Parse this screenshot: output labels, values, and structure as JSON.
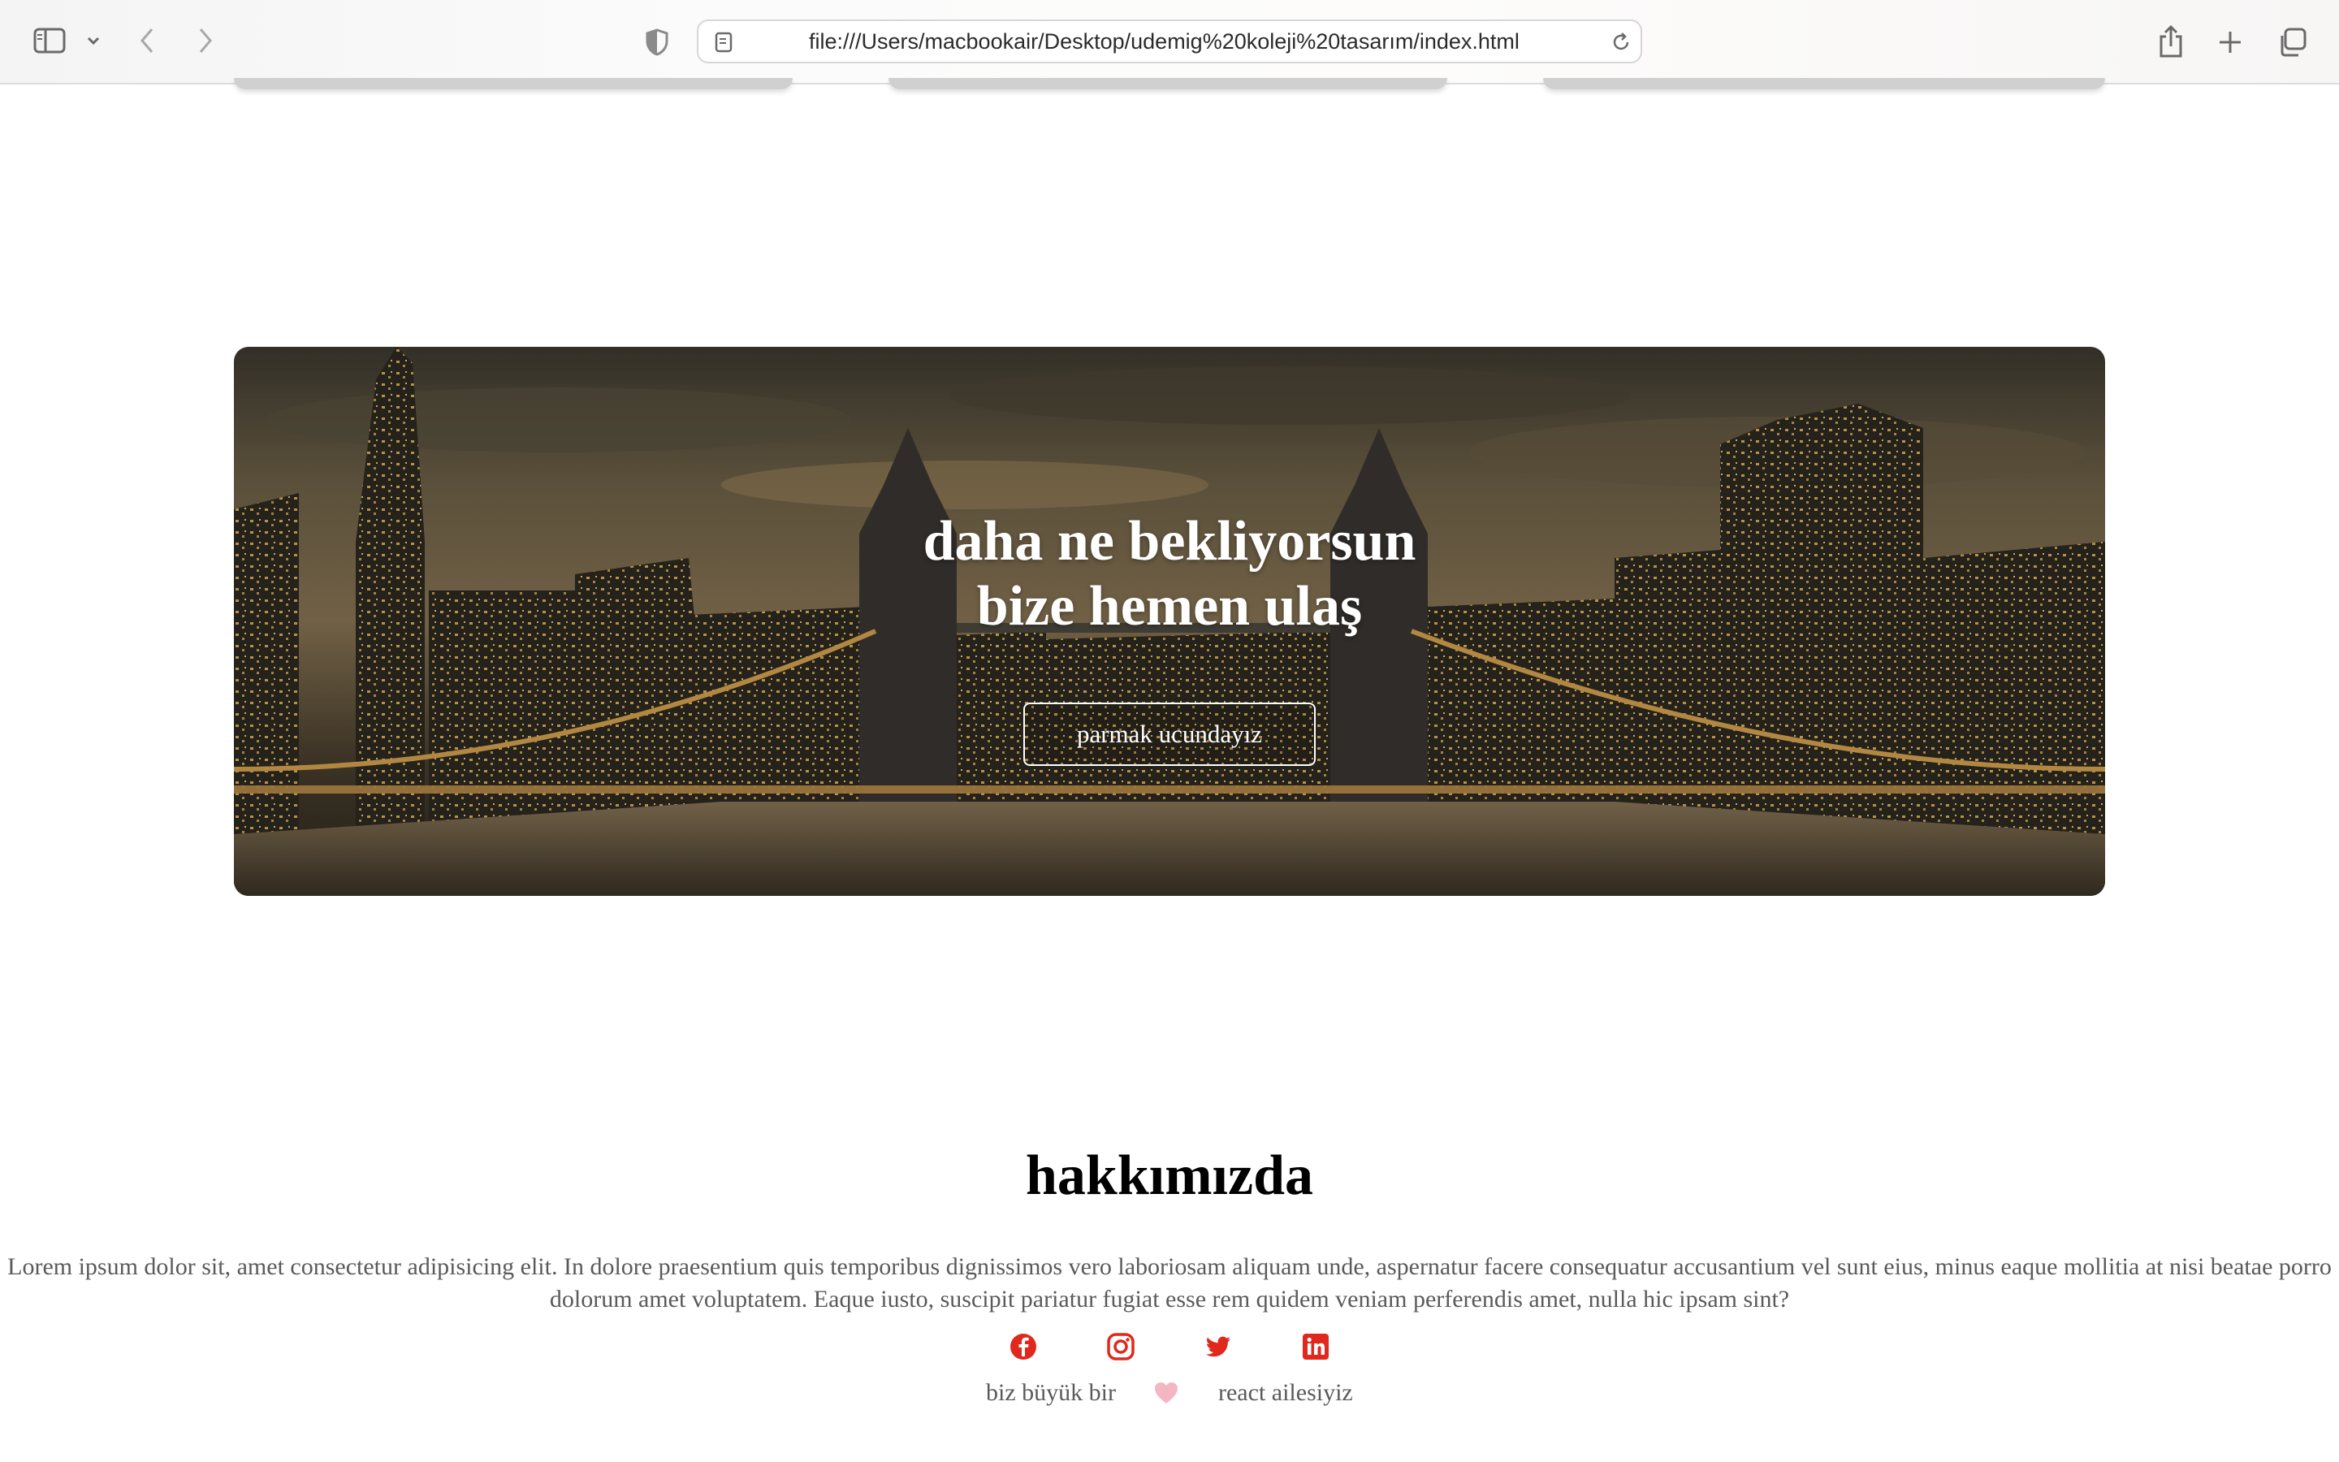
{
  "browser": {
    "url": "file:///Users/macbookair/Desktop/udemig%20koleji%20tasarım/index.html"
  },
  "hero": {
    "title_line1": "daha ne bekliyorsun",
    "title_line2": "bize hemen ulaş",
    "button_label": "parmak ucundayız"
  },
  "about": {
    "title": "hakkımızda",
    "text": "Lorem ipsum dolor sit, amet consectetur adipisicing elit. In dolore praesentium quis temporibus dignissimos vero laboriosam aliquam unde, aspernatur facere consequatur accusantium vel sunt eius, minus eaque mollitia at nisi beatae porro dolorum amet voluptatem. Eaque iusto, suscipit pariatur fugiat esse rem quidem veniam perferendis amet, nulla hic ipsam sint?",
    "socials": [
      {
        "icon": "facebook-icon"
      },
      {
        "icon": "instagram-icon"
      },
      {
        "icon": "twitter-icon"
      },
      {
        "icon": "linkedin-icon"
      }
    ],
    "accent_color": "#e0281c"
  },
  "footer": {
    "left_text": "biz büyük bir",
    "right_text": "react ailesiyiz",
    "heart_color": "#f4b6c2"
  }
}
